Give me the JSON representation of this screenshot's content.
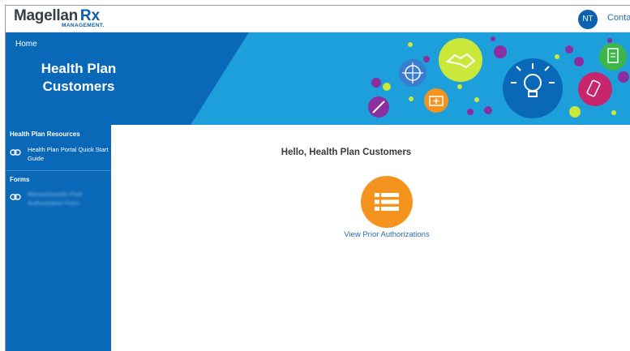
{
  "header": {
    "logo_word": "Magellan",
    "logo_rx": "Rx",
    "logo_sub": "MANAGEMENT.",
    "avatar_initials": "NT",
    "contact_label": "Contac"
  },
  "banner": {
    "home_link": "Home",
    "title": "Health Plan Customers",
    "colors": {
      "dark": "#0a68b8",
      "light": "#1d9fdc"
    }
  },
  "sidebar": {
    "sections": [
      {
        "heading": "Health Plan Resources",
        "links": [
          {
            "label": "Health Plan Portal Quick Start Guide",
            "icon": "link-icon"
          }
        ]
      },
      {
        "heading": "Forms",
        "links": [
          {
            "label": "Massachusetts Prior Authorization Form",
            "icon": "link-icon",
            "blurred": true
          }
        ]
      }
    ]
  },
  "main": {
    "greeting": "Hello, Health Plan Customers",
    "tile": {
      "label": "View Prior Authorizations",
      "icon": "list-icon",
      "color": "#f5931f"
    }
  }
}
